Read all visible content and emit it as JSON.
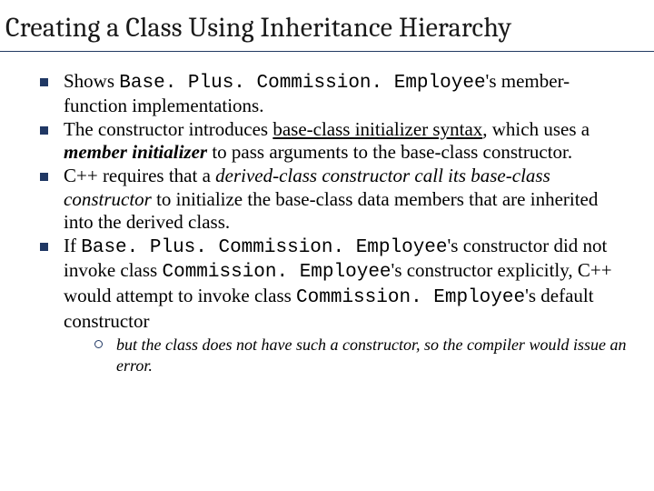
{
  "title": "Creating a Class Using Inheritance Hierarchy",
  "bullets": {
    "b1": {
      "pre": "Shows ",
      "code": "Base. Plus. Commission. Employee",
      "post": "'s member-function implementations."
    },
    "b2": {
      "pre": "The constructor introduces ",
      "u": "base-class initializer syntax",
      "mid": ", which uses a ",
      "bi": "member initializer",
      "post": " to pass arguments to the base-class constructor."
    },
    "b3": {
      "pre": "C++ requires that a ",
      "i": "derived-class constructor call its base-class constructor",
      "post": " to initialize the base-class data members that are inherited into the derived class."
    },
    "b4": {
      "pre": "If ",
      "code1": "Base. Plus. Commission. Employee",
      "mid1": "'s constructor did not invoke class ",
      "code2": "Commission. Employee",
      "mid2": "'s constructor explicitly, C++ would attempt to invoke class ",
      "code3": "Commission. Employee",
      "post": "'s default constructor"
    },
    "sub1": "but the class does not have such a constructor, so the compiler would issue an error."
  }
}
